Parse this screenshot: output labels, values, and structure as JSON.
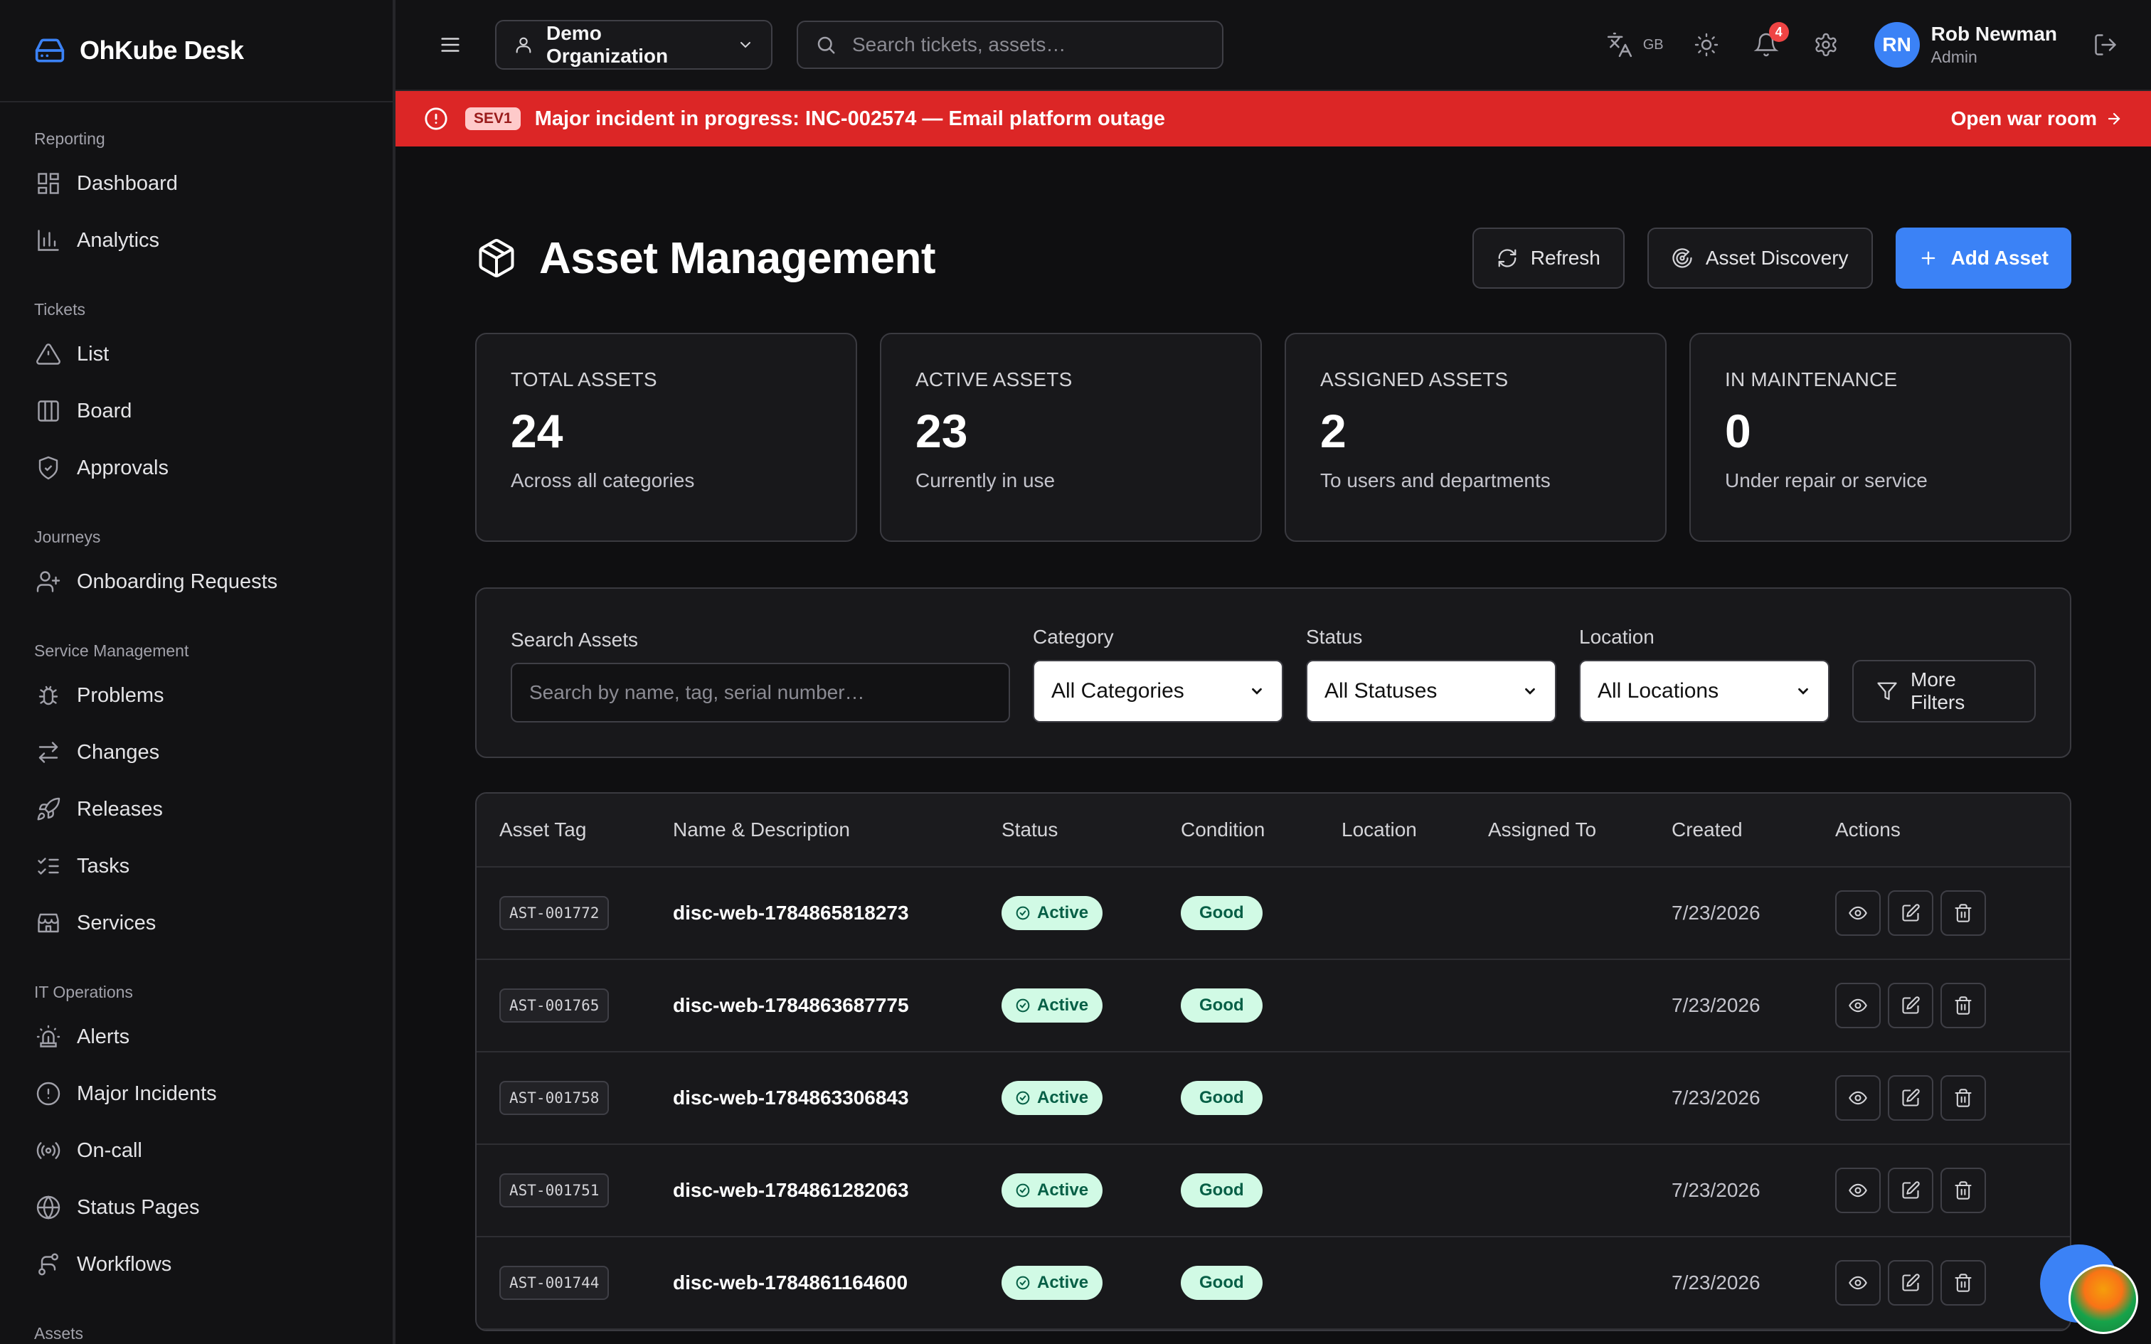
{
  "brand": {
    "name": "OhKube Desk"
  },
  "sidebar": {
    "sections": [
      {
        "heading": "Reporting",
        "items": [
          {
            "label": "Dashboard",
            "icon": "dashboard-icon"
          },
          {
            "label": "Analytics",
            "icon": "chart-icon"
          }
        ]
      },
      {
        "heading": "Tickets",
        "items": [
          {
            "label": "List",
            "icon": "alert-triangle-icon"
          },
          {
            "label": "Board",
            "icon": "columns-icon"
          },
          {
            "label": "Approvals",
            "icon": "shield-check-icon"
          }
        ]
      },
      {
        "heading": "Journeys",
        "items": [
          {
            "label": "Onboarding Requests",
            "icon": "user-plus-icon"
          }
        ]
      },
      {
        "heading": "Service Management",
        "items": [
          {
            "label": "Problems",
            "icon": "bug-icon"
          },
          {
            "label": "Changes",
            "icon": "arrows-swap-icon"
          },
          {
            "label": "Releases",
            "icon": "rocket-icon"
          },
          {
            "label": "Tasks",
            "icon": "list-checks-icon"
          },
          {
            "label": "Services",
            "icon": "store-icon"
          }
        ]
      },
      {
        "heading": "IT Operations",
        "items": [
          {
            "label": "Alerts",
            "icon": "siren-icon"
          },
          {
            "label": "Major Incidents",
            "icon": "alert-circle-icon"
          },
          {
            "label": "On-call",
            "icon": "radio-icon"
          },
          {
            "label": "Status Pages",
            "icon": "globe-icon"
          },
          {
            "label": "Workflows",
            "icon": "workflow-icon"
          }
        ]
      },
      {
        "heading": "Assets",
        "items": []
      }
    ]
  },
  "topbar": {
    "org": "Demo Organization",
    "search_placeholder": "Search tickets, assets…",
    "lang": "GB",
    "notifications": "4",
    "user": {
      "initials": "RN",
      "name": "Rob Newman",
      "role": "Admin"
    }
  },
  "banner": {
    "severity": "SEV1",
    "text": "Major incident in progress: INC-002574 — Email platform outage",
    "link": "Open war room",
    "color": "#dc2626"
  },
  "page": {
    "title": "Asset Management",
    "actions": {
      "refresh": "Refresh",
      "discovery": "Asset Discovery",
      "add": "Add Asset"
    },
    "accent": "#3b82f6"
  },
  "stats": [
    {
      "label": "TOTAL ASSETS",
      "value": "24",
      "sub": "Across all categories"
    },
    {
      "label": "ACTIVE ASSETS",
      "value": "23",
      "sub": "Currently in use"
    },
    {
      "label": "ASSIGNED ASSETS",
      "value": "2",
      "sub": "To users and departments"
    },
    {
      "label": "IN MAINTENANCE",
      "value": "0",
      "sub": "Under repair or service"
    }
  ],
  "filters": {
    "search_label": "Search Assets",
    "search_placeholder": "Search by name, tag, serial number…",
    "category_label": "Category",
    "category_value": "All Categories",
    "status_label": "Status",
    "status_value": "All Statuses",
    "location_label": "Location",
    "location_value": "All Locations",
    "more": "More Filters"
  },
  "table": {
    "columns": [
      "Asset Tag",
      "Name & Description",
      "Status",
      "Condition",
      "Location",
      "Assigned To",
      "Created",
      "Actions"
    ],
    "rows": [
      {
        "tag": "AST-001772",
        "name": "disc-web-1784865818273",
        "status": "Active",
        "condition": "Good",
        "location": "",
        "assigned": "",
        "created": "7/23/2026"
      },
      {
        "tag": "AST-001765",
        "name": "disc-web-1784863687775",
        "status": "Active",
        "condition": "Good",
        "location": "",
        "assigned": "",
        "created": "7/23/2026"
      },
      {
        "tag": "AST-001758",
        "name": "disc-web-1784863306843",
        "status": "Active",
        "condition": "Good",
        "location": "",
        "assigned": "",
        "created": "7/23/2026"
      },
      {
        "tag": "AST-001751",
        "name": "disc-web-1784861282063",
        "status": "Active",
        "condition": "Good",
        "location": "",
        "assigned": "",
        "created": "7/23/2026"
      },
      {
        "tag": "AST-001744",
        "name": "disc-web-1784861164600",
        "status": "Active",
        "condition": "Good",
        "location": "",
        "assigned": "",
        "created": "7/23/2026"
      }
    ]
  }
}
